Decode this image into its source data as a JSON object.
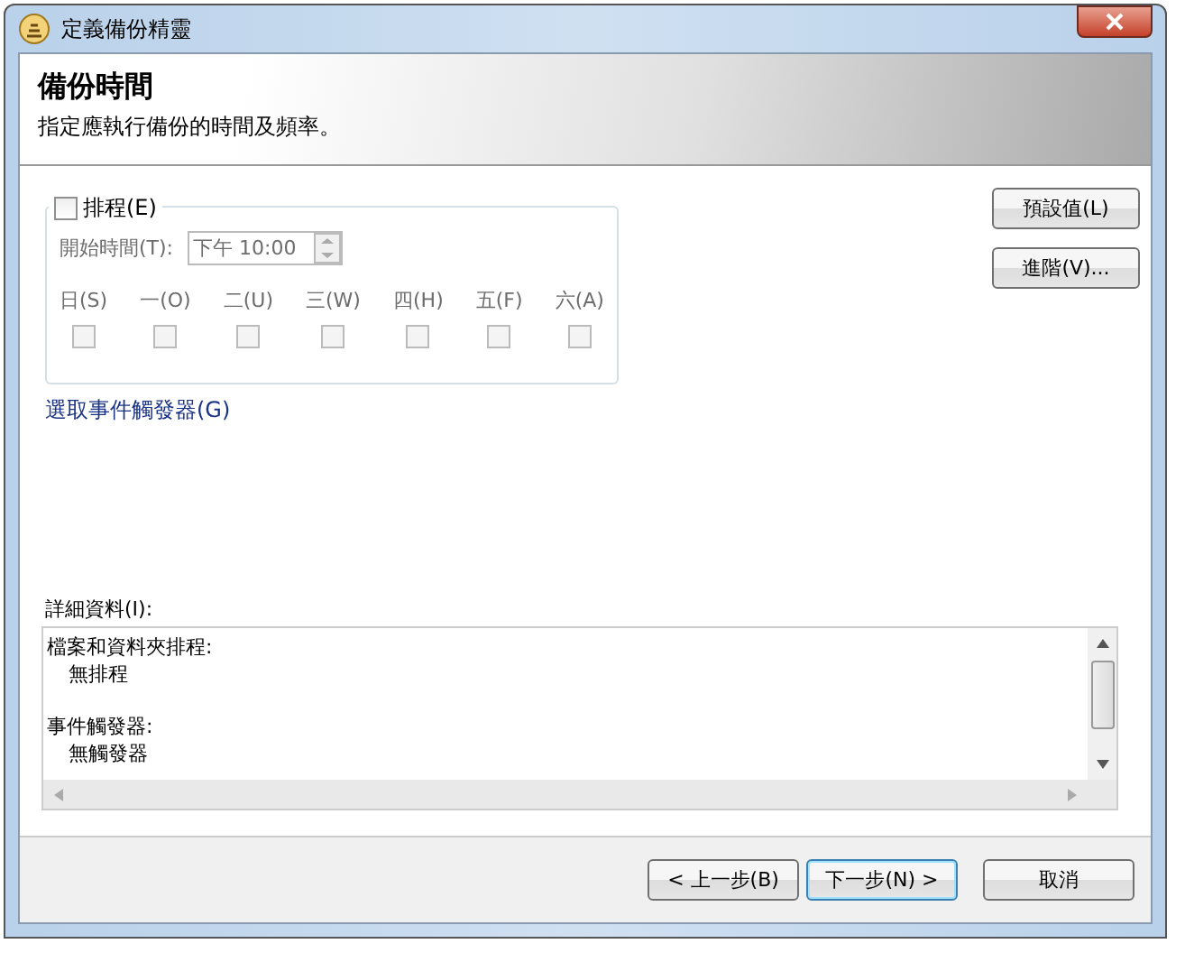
{
  "window": {
    "title": "定義備份精靈"
  },
  "header": {
    "title": "備份時間",
    "subtitle": "指定應執行備份的時間及頻率。"
  },
  "schedule": {
    "label": "排程(E)",
    "checked": false,
    "start_time_label": "開始時間(T):",
    "start_time": "下午 10:00",
    "disabled": true,
    "days": [
      {
        "label": "日(S)",
        "checked": false
      },
      {
        "label": "一(O)",
        "checked": false
      },
      {
        "label": "二(U)",
        "checked": false
      },
      {
        "label": "三(W)",
        "checked": false
      },
      {
        "label": "四(H)",
        "checked": false
      },
      {
        "label": "五(F)",
        "checked": false
      },
      {
        "label": "六(A)",
        "checked": false
      }
    ]
  },
  "side_buttons": [
    "預設值(L)",
    "進階(V)..."
  ],
  "event_trigger_link": "選取事件觸發器(G)",
  "details": {
    "label": "詳細資料(I):",
    "sections": [
      {
        "heading": "檔案和資料夾排程:",
        "value": "無排程"
      },
      {
        "heading": "事件觸發器:",
        "value": "無觸發器"
      }
    ]
  },
  "footer_buttons": [
    {
      "label": "< 上一步(B)",
      "default": false
    },
    {
      "label": "下一步(N) >",
      "default": true
    },
    {
      "label": "取消",
      "default": false
    }
  ]
}
